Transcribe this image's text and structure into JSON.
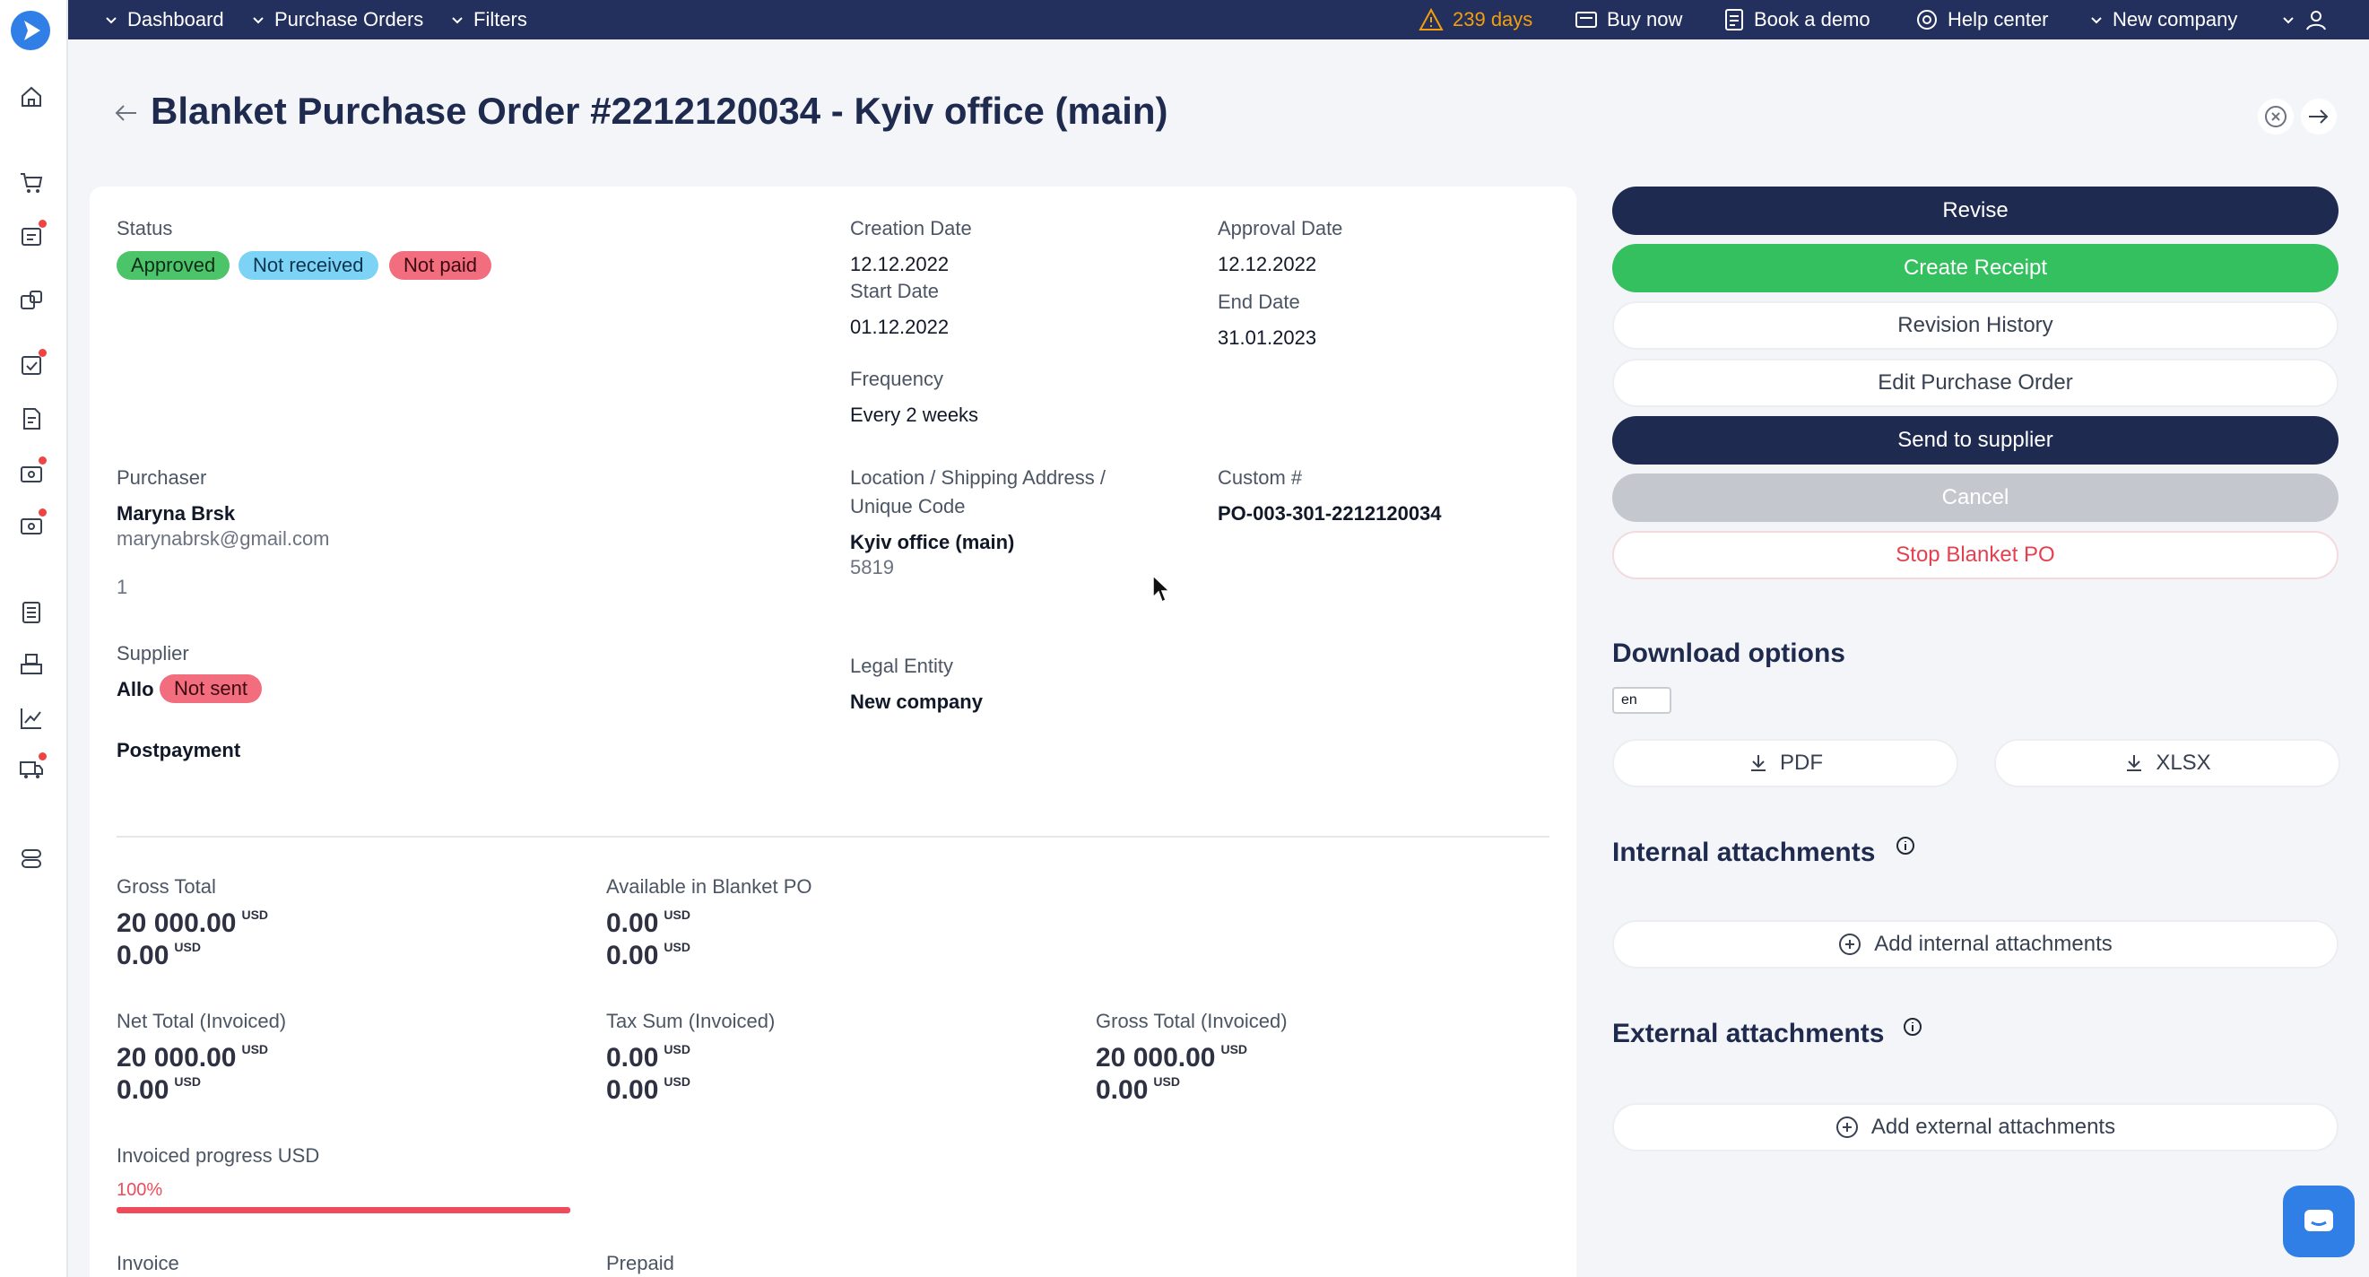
{
  "topbar": {
    "nav": [
      "Dashboard",
      "Purchase Orders",
      "Filters"
    ],
    "trial": "239 days",
    "buy_now": "Buy now",
    "book_demo": "Book a demo",
    "help_center": "Help center",
    "company": "New company"
  },
  "page": {
    "title": "Blanket Purchase Order #2212120034 - Kyiv office (main)"
  },
  "details": {
    "status_label": "Status",
    "status_badges": [
      "Approved",
      "Not received",
      "Not paid"
    ],
    "creation_date_label": "Creation Date",
    "creation_date": "12.12.2022",
    "approval_date_label": "Approval Date",
    "approval_date": "12.12.2022",
    "start_date_label": "Start Date",
    "start_date": "01.12.2022",
    "end_date_label": "End Date",
    "end_date": "31.01.2023",
    "frequency_label": "Frequency",
    "frequency": "Every 2 weeks",
    "purchaser_label": "Purchaser",
    "purchaser_name": "Maryna Brsk",
    "purchaser_email": "marynabrsk@gmail.com",
    "purchaser_extra": "1",
    "location_label_1": "Location / Shipping Address /",
    "location_label_2": "Unique Code",
    "location_name": "Kyiv office (main)",
    "location_code": "5819",
    "custom_label": "Custom #",
    "custom_value": "PO-003-301-2212120034",
    "supplier_label": "Supplier",
    "supplier_name": "Allo",
    "supplier_badge": "Not sent",
    "payment_type": "Postpayment",
    "legal_entity_label": "Legal Entity",
    "legal_entity": "New company"
  },
  "totals": {
    "currency": "USD",
    "gross_total_label": "Gross Total",
    "gross_total": "20 000.00",
    "gross_total_2": "0.00",
    "available_label": "Available in Blanket PO",
    "available": "0.00",
    "available_2": "0.00",
    "net_total_label": "Net Total (Invoiced)",
    "net_total": "20 000.00",
    "net_total_2": "0.00",
    "tax_sum_label": "Tax Sum (Invoiced)",
    "tax_sum": "0.00",
    "tax_sum_2": "0.00",
    "gross_invoiced_label": "Gross Total (Invoiced)",
    "gross_invoiced": "20 000.00",
    "gross_invoiced_2": "0.00",
    "progress_label": "Invoiced progress USD",
    "progress_text": "100%",
    "progress_fraction": 1.0,
    "invoice_label": "Invoice",
    "prepaid_label": "Prepaid"
  },
  "actions": {
    "revise": "Revise",
    "create_receipt": "Create Receipt",
    "revision_history": "Revision History",
    "edit_po": "Edit Purchase Order",
    "send_supplier": "Send to supplier",
    "cancel": "Cancel",
    "stop_blanket": "Stop Blanket PO"
  },
  "download": {
    "title": "Download options",
    "language": "en",
    "pdf": "PDF",
    "xlsx": "XLSX"
  },
  "attachments": {
    "internal_title": "Internal attachments",
    "internal_add": "Add internal attachments",
    "external_title": "External attachments",
    "external_add": "Add external attachments"
  },
  "colors": {
    "navy": "#23305d",
    "green": "#35c05f",
    "red": "#ef4b5b",
    "accent": "#2f7fe6"
  }
}
